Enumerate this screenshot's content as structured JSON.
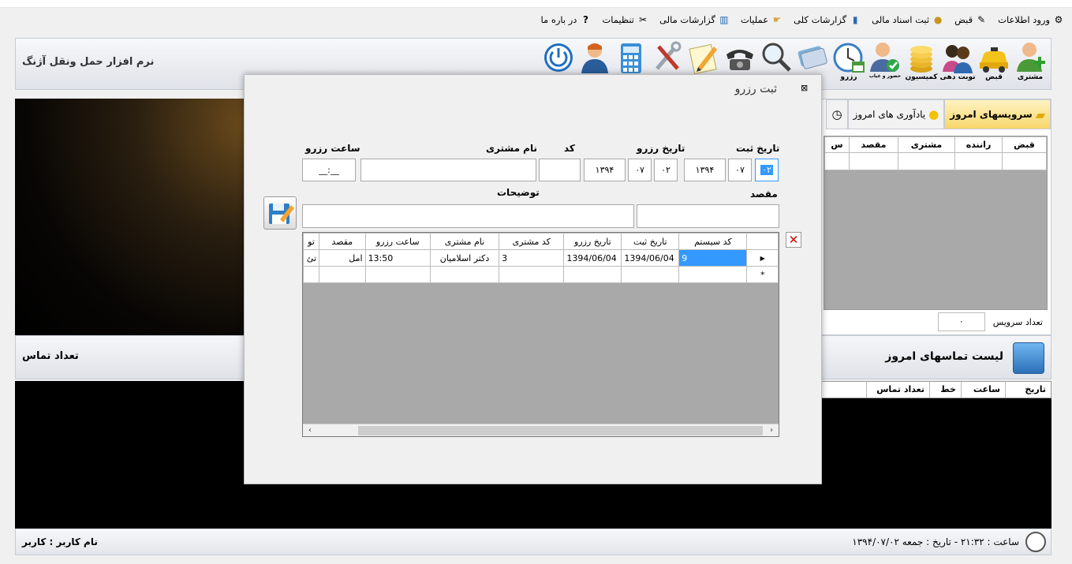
{
  "menu": [
    "ورود اطلاعات",
    "قبض",
    "ثبت اسناد مالی",
    "گزارشات کلی",
    "عملیات",
    "گزارشات مالی",
    "تنظیمات",
    "در باره ما"
  ],
  "app_title": "نرم افزار حمل ونقل آژنگ",
  "toolbar": [
    "مشتری",
    "قبض",
    "نوبت دهی",
    "کمیسیون",
    "حضور و غیاب",
    "رزرو",
    "",
    "",
    "",
    "",
    "",
    "",
    "",
    ""
  ],
  "tabs": {
    "today_services": "سرویسهای امروز",
    "reminders": "یادآوری های امروز"
  },
  "services_grid": {
    "columns": [
      "قبض",
      "راننده",
      "مشتری",
      "مقصد",
      "س"
    ]
  },
  "service_count": {
    "label": "تعداد سرویس",
    "value": "۰"
  },
  "calls": {
    "left_label": "تعداد تماس",
    "title": "لیست تماسهای امروز",
    "columns": [
      "تاریخ",
      "ساعت",
      "خط",
      "تعداد تماس"
    ]
  },
  "status": {
    "user": "نام کاربر : کاربر",
    "clock": "ساعت : ۲۱:۳۲ - تاریخ : جمعه ۱۳۹۴/۰۷/۰۲"
  },
  "dialog": {
    "title": "ثبت رزرو",
    "labels": {
      "reg_date": "تاریخ ثبت",
      "res_date": "تاریخ رزرو",
      "code": "کد",
      "customer_name": "نام مشتری",
      "res_time": "ساعت رزرو",
      "destination": "مقصد",
      "description": "توضیحات"
    },
    "reg_date": {
      "day": "۰۲",
      "month": "۰۷",
      "year": "۱۳۹۴"
    },
    "res_date": {
      "day": "۰۲",
      "month": "۰۷",
      "year": "۱۳۹۴"
    },
    "time_mask": "__:__",
    "close_symbol": "✕",
    "grid": {
      "columns": [
        "کد سیستم",
        "تاریخ ثبت",
        "تاریخ رزرو",
        "کد مشتری",
        "نام مشتری",
        "ساعت رزرو",
        "مقصد",
        "تو"
      ],
      "rows": [
        [
          "9",
          "1394/06/04",
          "1394/06/04",
          "3",
          "دکتر اسلامیان",
          "13:50",
          "امل",
          "تئ"
        ]
      ],
      "new_row_marker": "*",
      "current_row_marker": "▶"
    }
  }
}
